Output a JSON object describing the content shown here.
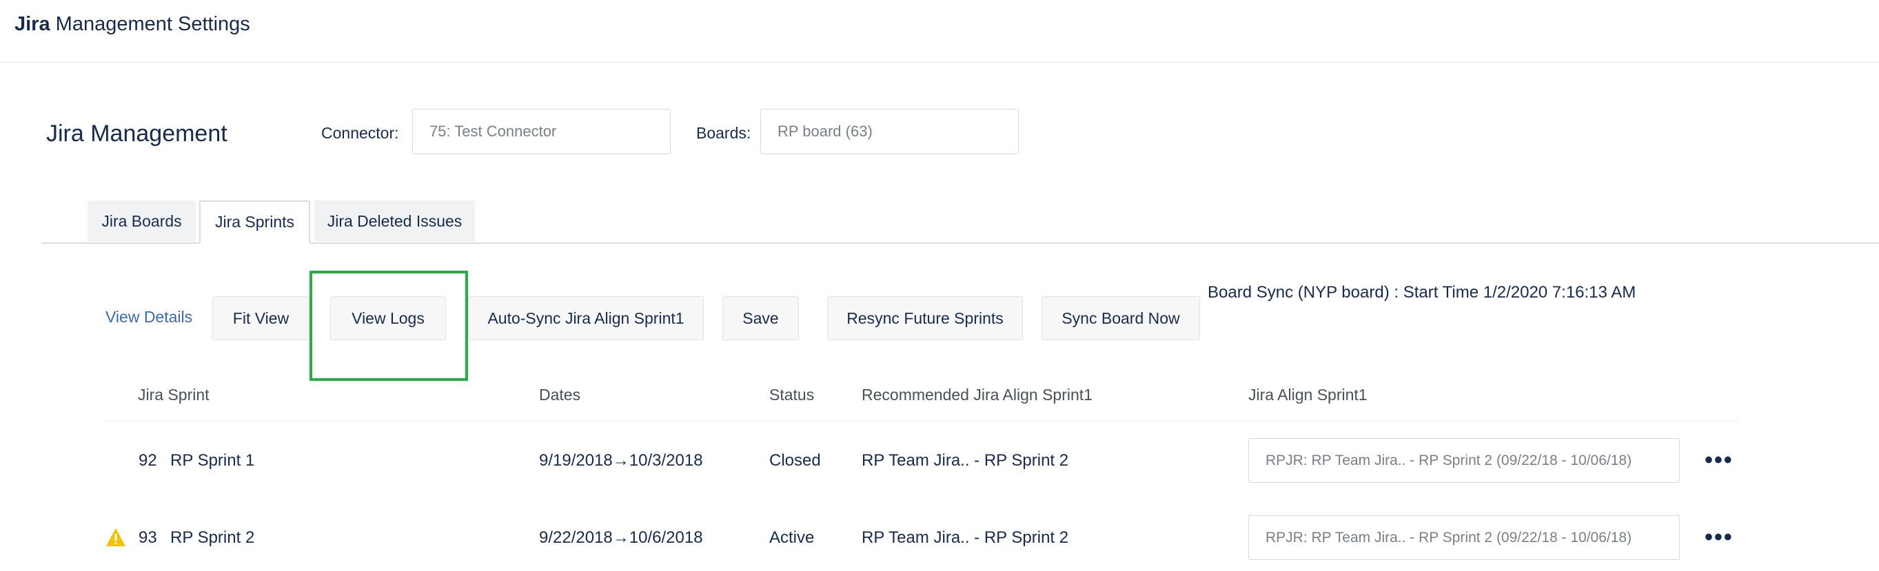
{
  "header": {
    "title_bold": "Jira",
    "title_rest": " Management Settings"
  },
  "page": {
    "title": "Jira Management",
    "connector_label": "Connector:",
    "connector_value": "75: Test Connector",
    "boards_label": "Boards:",
    "boards_value": "RP board (63)"
  },
  "tabs": [
    {
      "label": "Jira Boards",
      "active": false
    },
    {
      "label": "Jira Sprints",
      "active": true
    },
    {
      "label": "Jira Deleted Issues",
      "active": false
    }
  ],
  "toolbar": {
    "view_details": "View Details",
    "fit_view": "Fit View",
    "view_logs": "View Logs",
    "auto_sync": "Auto-Sync Jira Align Sprint1",
    "save": "Save",
    "resync": "Resync Future Sprints",
    "sync_now": "Sync Board Now",
    "highlight_color": "#27ae48"
  },
  "sync_status": "Board Sync (NYP board) : Start Time 1/2/2020 7:16:13 AM",
  "table": {
    "columns": [
      "Jira Sprint",
      "Dates",
      "Status",
      "Recommended Jira Align Sprint1",
      "Jira Align Sprint1"
    ],
    "rows": [
      {
        "warning": false,
        "id": "92",
        "name": "RP Sprint 1",
        "dates": "9/19/2018→10/3/2018",
        "status": "Closed",
        "recommended": "RP Team Jira.. - RP Sprint 2",
        "align_sprint": "RPJR: RP Team Jira.. - RP Sprint 2 (09/22/18 - 10/06/18)",
        "more": "•••"
      },
      {
        "warning": true,
        "id": "93",
        "name": "RP Sprint 2",
        "dates": "9/22/2018→10/6/2018",
        "status": "Active",
        "recommended": "RP Team Jira.. - RP Sprint 2",
        "align_sprint": "RPJR: RP Team Jira.. - RP Sprint 2 (09/22/18 - 10/06/18)",
        "more": "•••"
      }
    ]
  },
  "colors": {
    "warning": "#f2c200",
    "link": "#3a6aa8"
  }
}
